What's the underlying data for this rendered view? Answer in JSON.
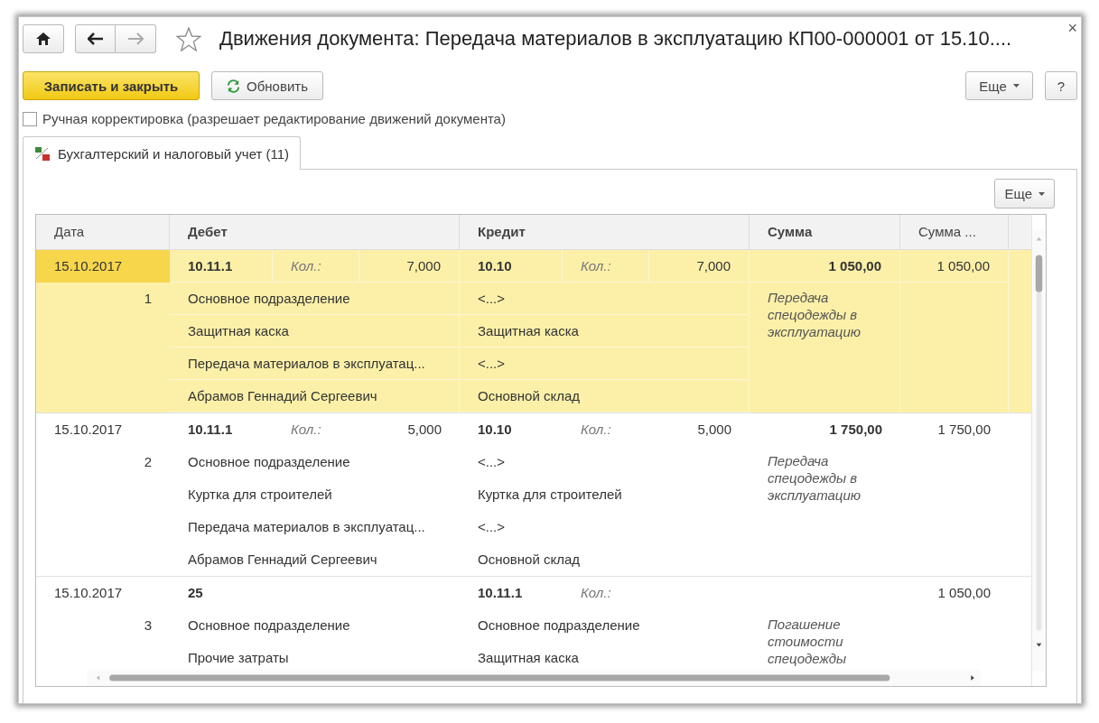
{
  "window": {
    "title": "Движения документа: Передача материалов в эксплуатацию КП00-000001 от 15.10....",
    "close": "×"
  },
  "toolbar": {
    "primary": "Записать и закрыть",
    "refresh": "Обновить",
    "more": "Еще",
    "help": "?"
  },
  "manual_edit": {
    "label": "Ручная корректировка (разрешает редактирование движений документа)",
    "checked": false
  },
  "tabs": [
    {
      "label": "Бухгалтерский и налоговый учет (11)",
      "selected": true
    }
  ],
  "table_more": "Еще",
  "columns": [
    {
      "label": "Дата",
      "bold": false,
      "kind": "single"
    },
    {
      "label": "Дебет",
      "bold": true,
      "kind": "side"
    },
    {
      "label": "Кредит",
      "bold": true,
      "kind": "side"
    },
    {
      "label": "Сумма",
      "bold": true,
      "kind": "single"
    },
    {
      "label": "Сумма ...",
      "bold": false,
      "kind": "single"
    }
  ],
  "rows": [
    {
      "selected": true,
      "date": "15.10.2017",
      "number": "1",
      "debit": {
        "account": "10.11.1",
        "qty_label": "Кол.:",
        "qty": "7,000",
        "subconto": [
          "Основное подразделение",
          "Защитная каска",
          "Передача материалов в эксплуатац...",
          "Абрамов Геннадий Сергеевич"
        ]
      },
      "credit": {
        "account": "10.10",
        "qty_label": "Кол.:",
        "qty": "7,000",
        "subconto": [
          "<...>",
          "Защитная каска",
          "<...>",
          "Основной склад"
        ]
      },
      "amount": "1 050,00",
      "content": "Передача спецодежды в эксплуатацию",
      "amount_2": "1 050,00"
    },
    {
      "selected": false,
      "date": "15.10.2017",
      "number": "2",
      "debit": {
        "account": "10.11.1",
        "qty_label": "Кол.:",
        "qty": "5,000",
        "subconto": [
          "Основное подразделение",
          "Куртка для строителей",
          "Передача материалов в эксплуатац...",
          "Абрамов Геннадий Сергеевич"
        ]
      },
      "credit": {
        "account": "10.10",
        "qty_label": "Кол.:",
        "qty": "5,000",
        "subconto": [
          "<...>",
          "Куртка для строителей",
          "<...>",
          "Основной склад"
        ]
      },
      "amount": "1 750,00",
      "content": "Передача спецодежды в эксплуатацию",
      "amount_2": "1 750,00"
    },
    {
      "selected": false,
      "date": "15.10.2017",
      "number": "3",
      "debit": {
        "account": "25",
        "subconto": [
          "Основное подразделение",
          "Прочие затраты"
        ]
      },
      "credit": {
        "account": "10.11.1",
        "qty_label": "Кол.:",
        "subconto": [
          "Основное подразделение",
          "Защитная каска"
        ]
      },
      "content": "Погашение стоимости спецодежды",
      "amount_2": "1 050,00"
    }
  ]
}
